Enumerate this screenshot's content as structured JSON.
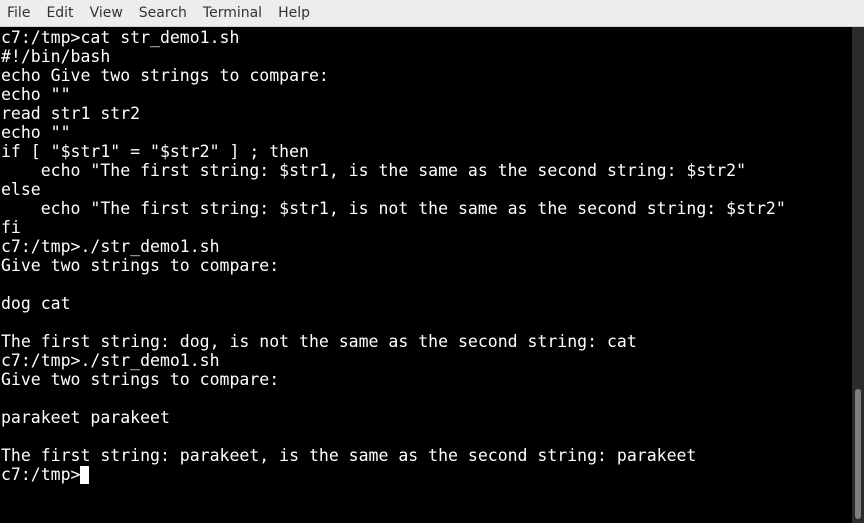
{
  "menu": {
    "items": [
      "File",
      "Edit",
      "View",
      "Search",
      "Terminal",
      "Help"
    ]
  },
  "terminal": {
    "lines": [
      "c7:/tmp>cat str_demo1.sh",
      "#!/bin/bash",
      "echo Give two strings to compare:",
      "echo \"\"",
      "read str1 str2",
      "echo \"\"",
      "if [ \"$str1\" = \"$str2\" ] ; then",
      "    echo \"The first string: $str1, is the same as the second string: $str2\"",
      "else",
      "    echo \"The first string: $str1, is not the same as the second string: $str2\"",
      "fi",
      "c7:/tmp>./str_demo1.sh",
      "Give two strings to compare:",
      "",
      "dog cat",
      "",
      "The first string: dog, is not the same as the second string: cat",
      "c7:/tmp>./str_demo1.sh",
      "Give two strings to compare:",
      "",
      "parakeet parakeet",
      "",
      "The first string: parakeet, is the same as the second string: parakeet"
    ],
    "prompt": "c7:/tmp>"
  },
  "colors": {
    "background": "#000000",
    "foreground": "#ffffff",
    "menubar": "#ededed"
  },
  "icons": [
    "cursor-block"
  ]
}
